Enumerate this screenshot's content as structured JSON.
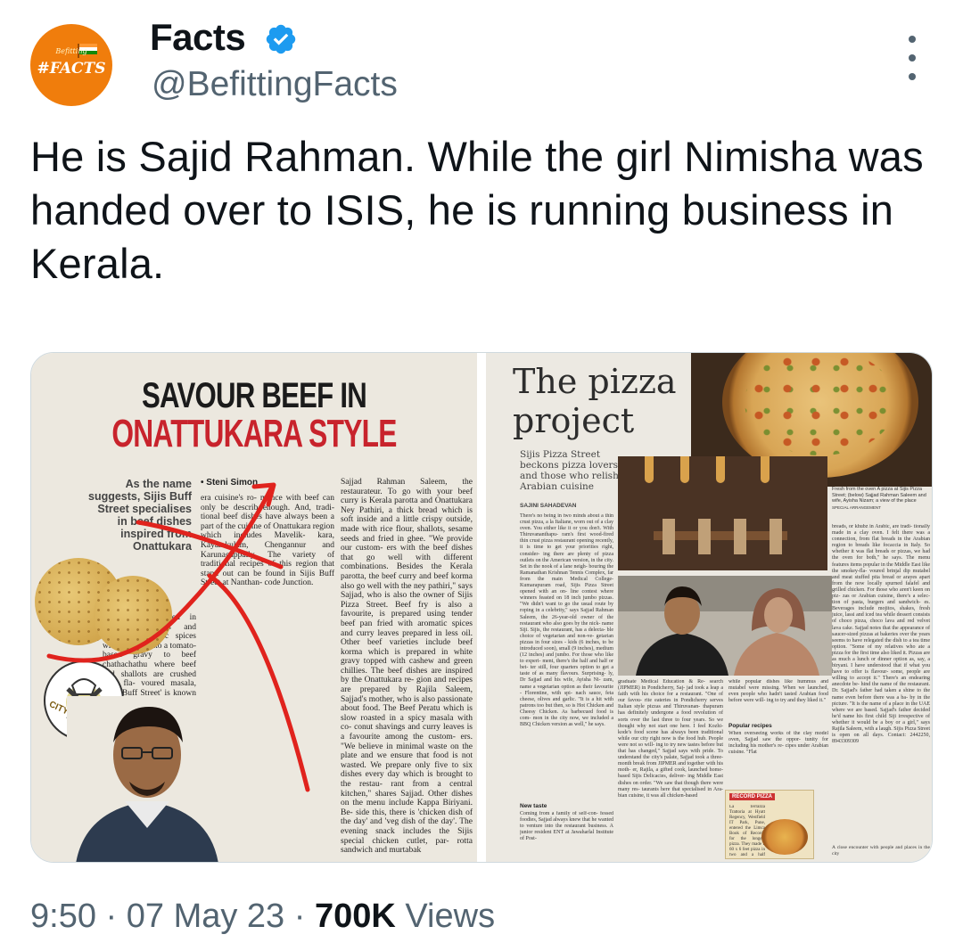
{
  "author": {
    "display_name": "Facts",
    "handle": "@BefittingFacts",
    "avatar_text_small": "Befitting",
    "avatar_text": "#FACTS",
    "verified": true,
    "verified_icon": "blue-check-badge-icon"
  },
  "tweet": {
    "text": "He is Sajid Rahman. While the girl Nimisha was handed over to ISIS, he is running business in Kerala."
  },
  "media": {
    "left_article": {
      "headline_line1": "SAVOUR BEEF IN",
      "headline_line2": "ONATTUKARA STYLE",
      "deck": "As the name suggests, Sijis Buff Street specialises in beef dishes inspired from Onattukara",
      "byline": "Steni Simon",
      "logo_text": "CITY BITES",
      "column_left": "era cuisine's ro- mance with beef can only be describ enough. And, tradi- tional beef dishes have always been a part of the cuisine of Onattukara region which includes Mavelik- kara, Kayamkulam, Chengannur and Karunagappally. The variety of traditional recipes of this region that stand out can be found in Sijis Buff Street at Nanthan- code Junction.",
      "column_left_lower": "Beef curry cooked in browned shallots and secret aro- matic spices which shrink into a tomato-based gravy to beef chathachathu where beef and shallots are crushed with fla- voured masala, 'Sijis Buff Street' is known for 'buff meat' and is a perfect desti- nation for beef lovers. 'Soup of Onattukara' which is a healthy blend of local pulses and vegetables simmered to perfection in traditional Onattukara style, is the welcome drink here. It's just been a week but Siji's special beef fry has become a sig- nature dish with a huge fan fol- lowing. \"When it comes to Thiruvanan- thapuram, there are lots of res- taurants serving chicken and mut-",
      "column_right": "Sajjad Rahman Saleem, the restaurateur. To go with your beef curry is Kerala parotta and Onattukara Ney Pathiri, a thick bread which is soft inside and a little crispy outside, made with rice flour, shallots, sesame seeds and fried in ghee. \"We provide our custom- ers with the beef dishes that go well with different combinations. Besides the Kerala parotta, the beef curry and beef korma also go well with the ney pathiri,\" says Sajjad, who is also the owner of Sijis Pizza Street. Beef fry is also a favourite, is prepared using tender beef pan fried with aromatic spices and curry leaves prepared in less oil. Other beef varieties include beef korma which is prepared in white gravy topped with cashew and green chillies. The beef dishes are inspired by the Onattukara re- gion and recipes are prepared by Rajila Saleem, Sajjad's mother, who is also passionate about food. The Beef Peratu which is slow roasted in a spicy masala with co- conut shavings and curry leaves is a favourite among the custom- ers. \"We believe in minimal waste on the plate and we ensure that food is not wasted. We prepare only five to six dishes every day which is brought to the restau- rant from a central kitchen,\" shares Sajjad. Other dishes on the menu include Kappa Biriyani. Be- side this, there is 'chicken dish of the day' and 'veg dish of the day'. The evening snack includes the Sijis special chicken cutlet, par- rotta sandwich and murtabak"
    },
    "right_article": {
      "headline_line1": "The pizza",
      "headline_line2": "project",
      "deck": "Sijis Pizza Street beckons pizza lovers and those who relish Arabian cuisine",
      "byline": "SAJINI SAHADEVAN",
      "col_a": "There's no being in two minds about a thin crust pizza, a la Italiane, worn out of a clay oven. You either like it or you don't. With Thiruvananthapu- ram's first wood-fired thin crust pizza restaurant opening recently, it is time to get your priorities right, consider- ing there are plenty of pizza outlets on the American version, in the city. Set in the nook of a lane neigh- bouring the Ramanathan Krishnan Tennis Complex, far from the main Medical College-Kumarapuram road, Sijis Pizza Street opened with an on- line contest where winners feasted on 18 inch jumbo pizzas. \"We didn't want to go the usual route by roping in a celebrity,\" says Sajjad Rahman Saleem, the 26-year-old owner of the restaurant who also goes by the nick- name Siji. Sijis, the restaurant, has a delecta- ble choice of vegetarian and non-ve- getarian pizzas in four sizes - kids (6 inches, to be introduced soon), small (9 inches), medium (12 inches) and jumbo. For those who like to experi- ment, there's the half and half or bet- ter still, four quarters option to get a taste of as many flavours. Surprising- ly, Dr Sajjad and his wife, Ayisha Ni- zam, name a vegetarian option as their favourite - Florentine, with spi- nach sauce, feta cheese, olives and garlic. \"It is a hit with patrons too but then, so is Hot Chicken and Cheesy Chicken. As barbecued food is com- mon in the city now, we included a BBQ Chicken version as well,\" he says.",
      "subhead_new_taste": "New taste",
      "col_new_taste": "Coming from a family of self-con- fessed foodies, Sajjad always knew that he wanted to venture into the restaurant business. A junior resident ENT at Jawaharlal Institute of Post-",
      "col_b": "graduate Medical Education & Re- search (JIPMER) in Pondicherry, Saj- jad took a leap a faith with his choice for a restaurant. \"One of our favou- rite eateries in Pondicherry serves Italian style pizzas and Thiruvanan- thapuram has definitely undergone a food revolution of sorts over the last three to four years. So we thought why not start one here. I feel Kozhi- kode's food scene has always been traditional while our city right now is the food hub. People were not so will- ing to try new tastes before but that has changed,\" Sajjad says with pride. To understand the city's palate, Sajjad took a three-month break from JIPMER and together with his moth- er, Rajila, a gifted cook, launched home-based Sijis Delicacies, deliver- ing Middle East dishes on order. \"We saw that though there were many res- taurants here that specialised in Ara- bian cuisine, it was all chicken-based",
      "col_c": "while popular dishes like hummus and mutabel were missing. When we launched, even people who hadn't tasted Arabian food before were will- ing to try and they liked it.\"",
      "subhead_popular": "Popular recipes",
      "col_popular": "When overseeing works of the clay model oven, Sajjad saw the oppor- tunity for including his mother's re- cipes under Arabian cuisine. \"Flat",
      "record_box_title": "RECORD PIZZA",
      "record_box_text": "La Terrazza Trattoria at Hyatt Regency, Westfield IT Park, Pune, entered the Limca Book of Records for the longest pizza. They made a 60 x 6 feet pizza in two and a half hours",
      "caption": "Fresh from the oven A pizza at Sijis Pizza Street; (below) Sajjad Rahman Saleem and wife, Ayisha Nizam; a view of the place",
      "caption_credit": "SPECIAL ARRANGEMENT",
      "col_d": "breads, or khubz in Arabic, are tradi- tionally made in a clay oven. I felt there was a connection, from flat breads in the Arabian region to breads like focaccia in Italy. So whether it was flat breads or pizzas, we had the oven for both,\" he says. The menu features items popular in the Middle East like the smokey-fla- voured brinjal dip mutabel and meat stuffed pita bread or arayes apart from the now locally spurned falafel and grilled chicken. For those who aren't keen on piz- zas or Arabian cuisine, there's a selec- tion of pasta, burgers and sandwich- es. Beverages include mojitos, shakes, fresh juice, lassi and iced tea while dessert consists of choco pizza, choco lava and red velvet lava cake. Sajjad notes that the appearance of saucer-sized pizzas at bakeries over the years seems to have relegated the dish to a tea time option. \"Some of my relatives who ate a pizza for the first time also liked it. Pizzas are as much a lunch or dinner option as, say, a biryani. I have understood that if what you have to offer is flavour- some, people are willing to accept it.\" There's an endearing anecdote be- hind the name of the restaurant. Dr. Sajjad's father had taken a shine to the name even before there was a ba- by in the picture. \"It is the name of a place in the UAE where we are based. Sajjad's father decided he'd name his first child Siji irrespective of whether it would be a boy or a girl,\" says Rajila Saleem, with a laugh. Sijis Pizza Street is open on all days. Contact: 2442250, 8943309309",
      "col_d_caption": "A close encounter with people and places in the city"
    }
  },
  "footer": {
    "time": "9:50",
    "separator": "·",
    "date": "07 May 23",
    "views_count": "700K",
    "views_label": "Views"
  },
  "colors": {
    "text_primary": "#0f1419",
    "text_secondary": "#536471",
    "verified_blue": "#1d9bf0",
    "avatar_orange": "#f07d0c",
    "headline_red": "#c8232c",
    "annotation_red": "#e0231d"
  }
}
